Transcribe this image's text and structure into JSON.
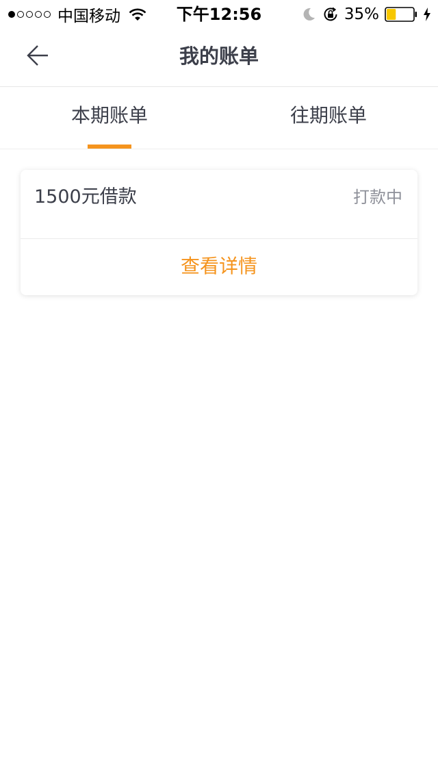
{
  "status_bar": {
    "carrier": "中国移动",
    "time": "下午12:56",
    "battery_percent": "35%",
    "battery_level": 0.35,
    "signal_strength": 1,
    "signal_total": 5,
    "icons": [
      "wifi-icon",
      "moon-icon",
      "orientation-lock-icon",
      "battery-icon",
      "charging-icon"
    ]
  },
  "nav": {
    "title": "我的账单",
    "back_icon": "back-arrow-icon"
  },
  "tabs": [
    {
      "label": "本期账单",
      "selected": true
    },
    {
      "label": "往期账单",
      "selected": false
    }
  ],
  "bill": {
    "name": "1500元借款",
    "status": "打款中",
    "detail_label": "查看详情"
  },
  "colors": {
    "accent": "#f5941e",
    "text_primary": "#3c3f4a",
    "text_secondary": "#8e9099",
    "battery_fill": "#f7c700"
  }
}
